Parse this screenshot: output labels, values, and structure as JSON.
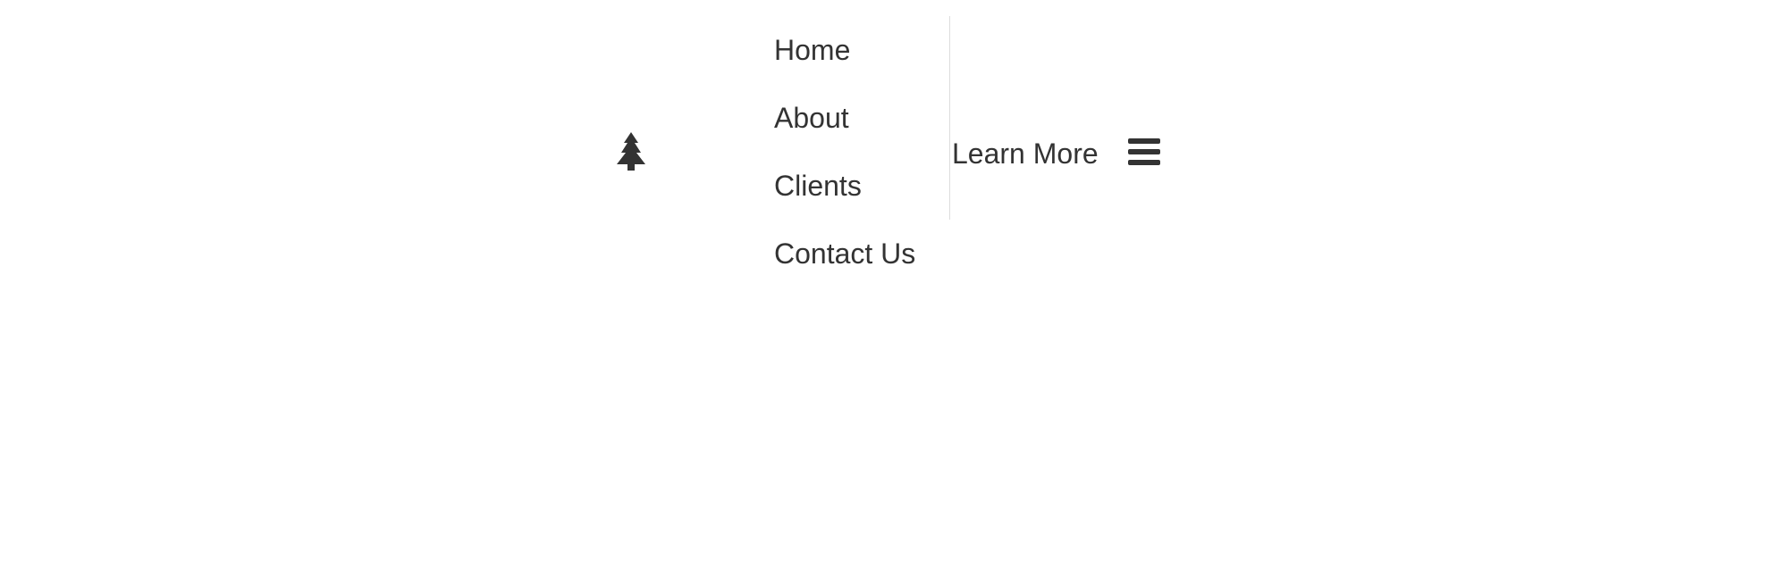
{
  "header": {
    "logo_icon": "tree-icon",
    "nav_items": [
      {
        "label": "Home"
      },
      {
        "label": "About"
      },
      {
        "label": "Clients"
      },
      {
        "label": "Contact Us"
      }
    ],
    "cta_label": "Learn More",
    "menu_icon": "hamburger-menu-icon"
  },
  "colors": {
    "text": "#333333",
    "divider": "#dddddd",
    "background": "#ffffff"
  }
}
